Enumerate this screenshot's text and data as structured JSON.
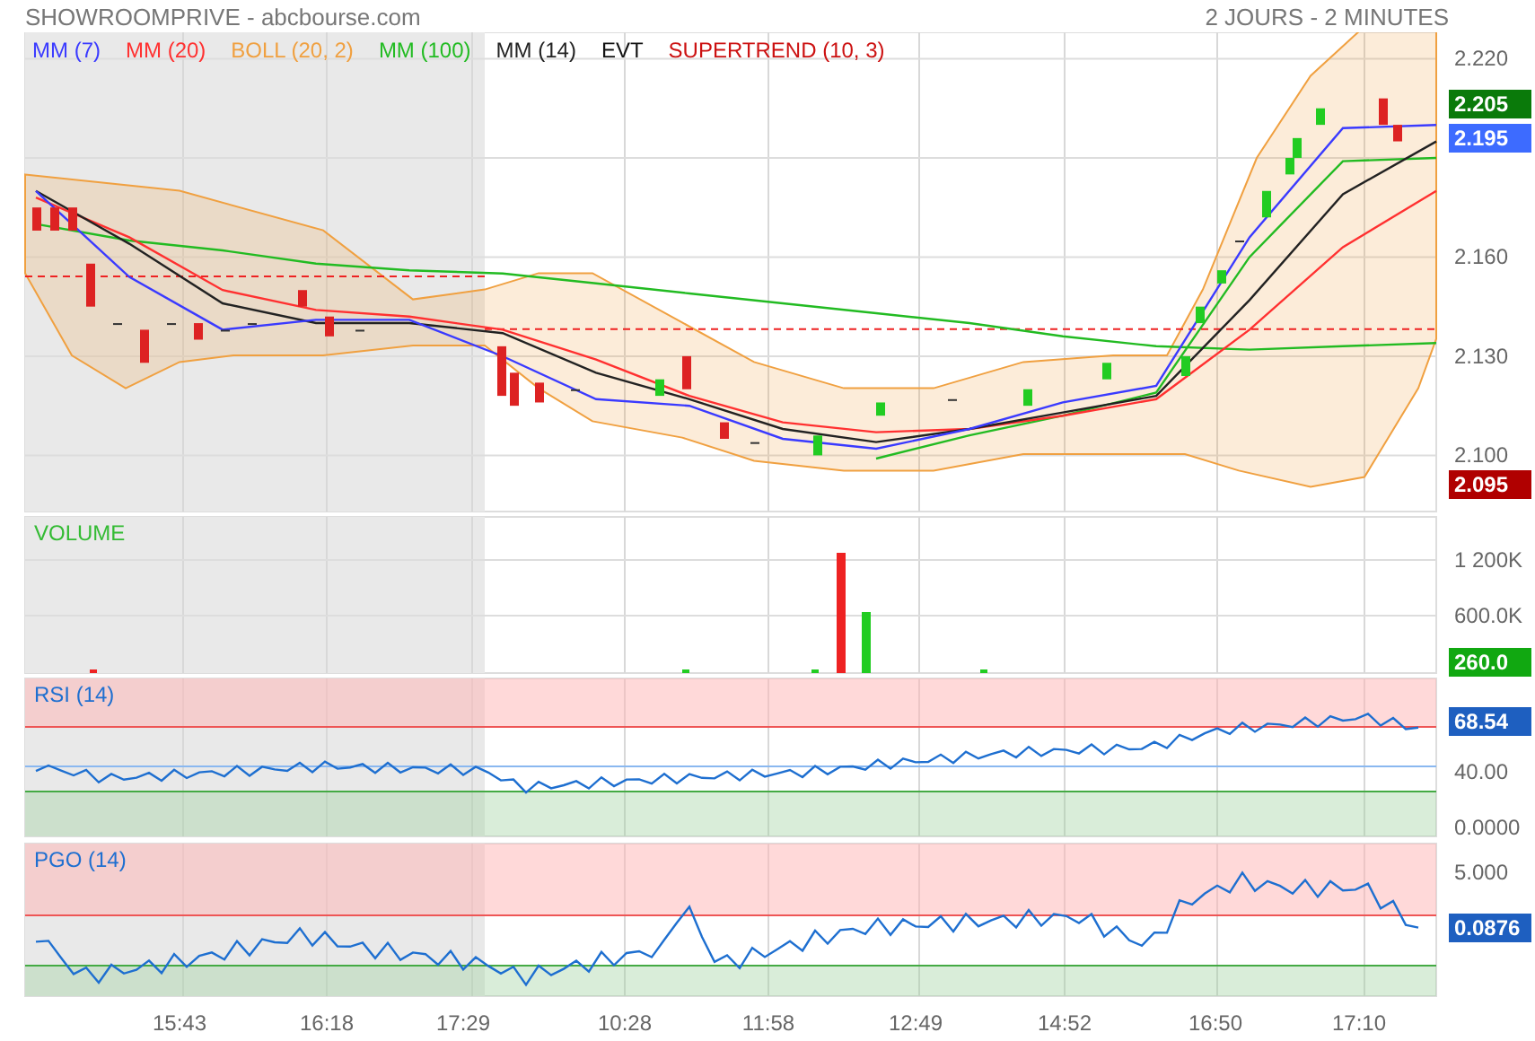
{
  "header": {
    "title": "SHOWROOMPRIVE - abcbourse.com",
    "period": "2 JOURS - 2 MINUTES"
  },
  "price_panel": {
    "legend": [
      {
        "label": "MM (7)",
        "color": "#3a3aff"
      },
      {
        "label": "MM (20)",
        "color": "#ff3030"
      },
      {
        "label": "BOLL (20, 2)",
        "color": "#f0a040"
      },
      {
        "label": "MM (100)",
        "color": "#22bb22"
      },
      {
        "label": "MM (14)",
        "color": "#222222"
      },
      {
        "label": "EVT",
        "color": "#111111"
      },
      {
        "label": "SUPERTREND (10, 3)",
        "color": "#cc1111"
      }
    ],
    "chart_data": {
      "type": "line",
      "ylim": [
        2.083,
        2.228
      ],
      "yticks": [
        {
          "value": 2.22,
          "label": "2.220"
        },
        {
          "value": 2.16,
          "label": "2.160"
        },
        {
          "value": 2.13,
          "label": "2.130"
        },
        {
          "value": 2.1,
          "label": "2.100"
        }
      ],
      "series": [
        {
          "color": "#22bb22",
          "values": [
            2.17,
            2.165,
            2.162,
            2.158,
            2.156,
            2.155,
            2.152,
            2.149,
            2.146,
            2.143,
            2.14,
            2.136,
            2.133,
            2.132,
            2.133,
            2.134
          ]
        },
        {
          "color": "#22bb22",
          "values": [
            null,
            null,
            null,
            null,
            null,
            null,
            null,
            null,
            null,
            2.099,
            2.106,
            2.112,
            2.119,
            2.16,
            2.189,
            2.19
          ]
        },
        {
          "color": "#ff3030",
          "values": [
            2.178,
            2.166,
            2.15,
            2.144,
            2.142,
            2.138,
            2.129,
            2.118,
            2.11,
            2.107,
            2.108,
            2.112,
            2.117,
            2.138,
            2.163,
            2.18
          ]
        },
        {
          "color": "#222222",
          "values": [
            2.18,
            2.164,
            2.146,
            2.14,
            2.14,
            2.137,
            2.125,
            2.117,
            2.108,
            2.104,
            2.108,
            2.113,
            2.118,
            2.147,
            2.179,
            2.195
          ]
        },
        {
          "color": "#3a3aff",
          "values": [
            2.18,
            2.154,
            2.138,
            2.141,
            2.141,
            2.13,
            2.117,
            2.115,
            2.105,
            2.102,
            2.108,
            2.116,
            2.121,
            2.166,
            2.199,
            2.2
          ]
        }
      ]
    },
    "badges": [
      {
        "text": "2.205",
        "color": "#0a7a0a"
      },
      {
        "text": "2.195",
        "color": "#3d6bff"
      },
      {
        "text": "2.095",
        "color": "#b00000"
      }
    ]
  },
  "volume_panel": {
    "title": "VOLUME",
    "axis_labels": [
      "1 200K",
      "600.0K"
    ],
    "badges": [
      {
        "text": "260.0",
        "color": "#11a811"
      }
    ]
  },
  "rsi_panel": {
    "title": "RSI (14)",
    "axis_labels": [
      "40.00",
      "0.0000"
    ],
    "badges": [
      {
        "text": "68.54",
        "color": "#1e5fc0"
      }
    ]
  },
  "pgo_panel": {
    "title": "PGO (14)",
    "axis_labels": [
      "5.000"
    ],
    "badges": [
      {
        "text": "0.0876",
        "color": "#1e5fc0"
      }
    ]
  },
  "time_axis": [
    "15:43",
    "16:18",
    "17:29",
    "10:28",
    "11:58",
    "12:49",
    "14:52",
    "16:50",
    "17:10"
  ]
}
